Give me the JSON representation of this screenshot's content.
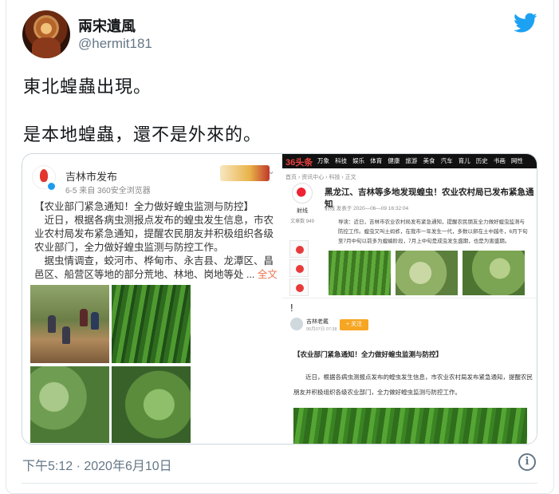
{
  "tweet": {
    "author_name": "兩宋遺風",
    "handle": "@hermit181",
    "text_line1": "東北蝗蟲出現。",
    "text_line2": "是本地蝗蟲，還不是外來的。",
    "timestamp": "下午5:12 · 2020年6月10日"
  },
  "icons": {
    "brand": "twitter-bird-icon",
    "info": "info-icon"
  },
  "colors": {
    "twitter_blue": "#1da1f2",
    "secondary_text": "#657786",
    "weibo_link": "#eb7350",
    "toutiao_red": "#ed4040"
  },
  "weibo_post": {
    "account": "吉林市发布",
    "meta": "6-5  来自 360安全浏览器",
    "body": "【农业部门紧急通知！全力做好蝗虫监测与防控】\n　近日，根据各病虫测报点发布的蝗虫发生信息，市农业农村局发布紧急通知，提醒农民朋友并积极组织各级农业部门，全力做好蝗虫监测与防控工作。\n　据虫情调查，蛟河市、桦甸市、永吉县、龙潭区、昌邑区、船营区等地的部分荒地、林地、岗地等处 ...",
    "more_link": "全文"
  },
  "toutiao_article": {
    "logo": "36头条",
    "nav": "万象 科技 娱乐 体育 健康 旅游 美食 汽车 育儿 历史 书画 网性",
    "crumb": "首页 › 资讯中心 › 科技 › 正文",
    "source": "射线",
    "source_sub": "文章数 949",
    "title": "黑龙江、吉林等多地发现蝗虫！农业农村局已发布紧急通知",
    "date": "射线 发表于 2020—06—09 16:32:04",
    "lead": "导读：近日，吉林市农业农村局发布紧急通知，提醒农民朋友全力做好蝗虫监测与防控工作。蝗虫又叫土蚂蚱，在我市一年发生一代，多数以卵在土中越冬，6月下旬至7月中旬以前多为蝗蝻阶段，7月上中旬是成虫发生盛期，也是为害盛期。"
  },
  "wukong_article": {
    "exclaim": "!",
    "author": "吉林老戴",
    "time": "06月07日 07:38",
    "follow": "+ 关注",
    "title": "【农业部门紧急通知！全力做好蝗虫监测与防控】",
    "paragraph": "近日，根据各病虫测报点发布的蝗虫发生信息，市农业农村局发布紧急通知，提醒农民朋友并积极组织各级农业部门，全力做好蝗虫监测与防控工作。"
  }
}
